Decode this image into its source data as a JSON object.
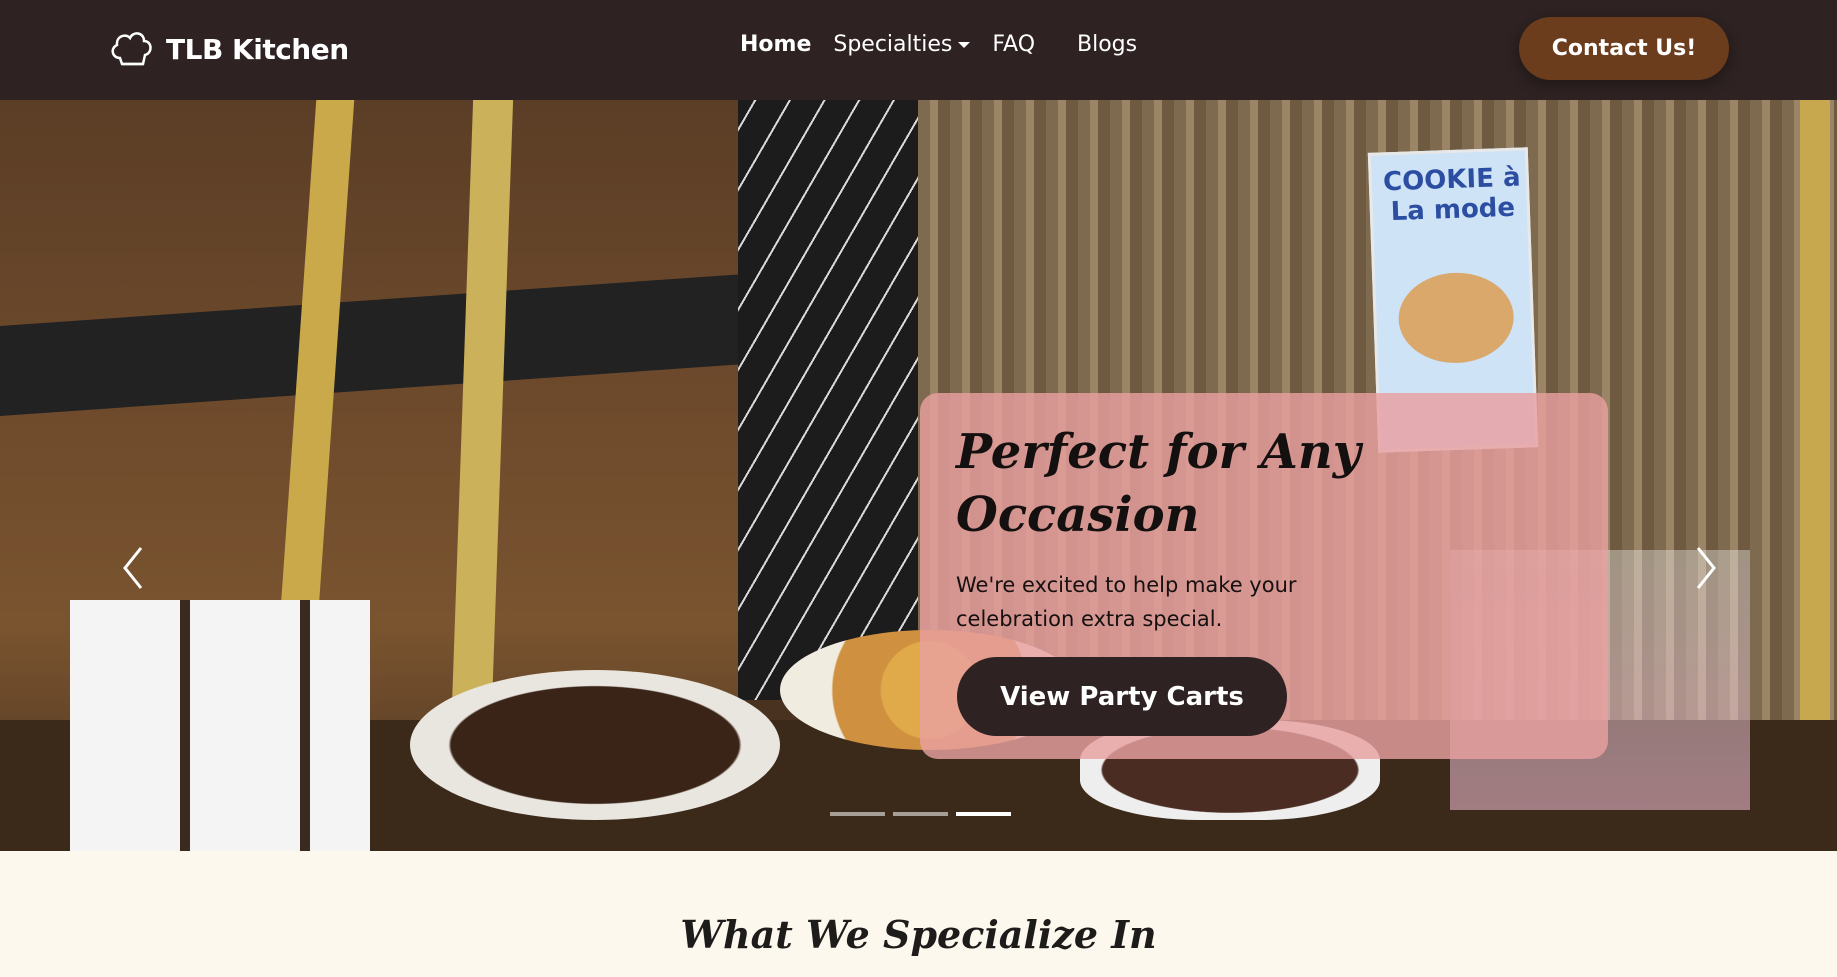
{
  "navbar": {
    "brand": "TLB Kitchen",
    "links": [
      {
        "label": "Home",
        "active": true
      },
      {
        "label": "Specialties",
        "dropdown": true
      },
      {
        "label": "FAQ"
      },
      {
        "label": "Blogs"
      }
    ],
    "contact_label": "Contact Us!",
    "colors": {
      "background": "#2e2222",
      "contact_button": "#6b3d1d"
    }
  },
  "hero": {
    "title": "Perfect for Any Occasion",
    "subtitle": "We're excited to help make your celebration extra special.",
    "button_label": "View Party Carts",
    "sign_text": "COOKIE à La mode",
    "overlay_color": "#e8a0a0",
    "slide_count": 3,
    "active_slide": 3
  },
  "section": {
    "title": "What We Specialize In"
  }
}
